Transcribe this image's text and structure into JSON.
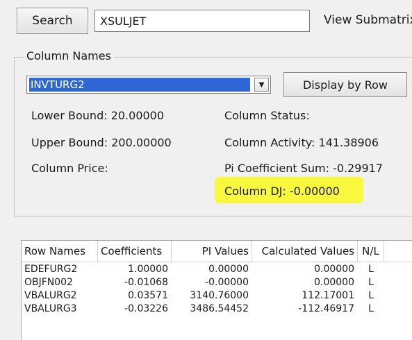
{
  "toolbar": {
    "search_label": "Search",
    "search_value": "XSULJET",
    "view_submatrix_label": "View Submatrix"
  },
  "column_group": {
    "title": "Column Names",
    "selected_column": "INVTURG2",
    "display_by_row_label": "Display by Row",
    "lower_bound": "Lower Bound: 20.00000",
    "upper_bound": "Upper Bound: 200.00000",
    "column_price": "Column Price:",
    "column_status": "Column Status:",
    "column_activity": "Column Activity: 141.38906",
    "pi_coefficient_sum": "Pi Coefficient Sum: -0.29917",
    "column_dj": "Column DJ: -0.00000",
    "highlight_color": "#f8f83c"
  },
  "grid": {
    "headers": [
      "Row Names",
      "Coefficients",
      "PI Values",
      "Calculated Values",
      "N/L"
    ],
    "rows": [
      [
        "EDEFURG2",
        "1.00000",
        "0.00000",
        "0.00000",
        "L"
      ],
      [
        "OBJFN002",
        "-0.01068",
        "-0.00000",
        "0.00000",
        "L"
      ],
      [
        "VBALURG2",
        "0.03571",
        "3140.76000",
        "112.17001",
        "L"
      ],
      [
        "VBALURG3",
        "-0.03226",
        "3486.54452",
        "-112.46917",
        "L"
      ]
    ]
  },
  "icons": {
    "dropdown": "chevron-down-icon"
  }
}
